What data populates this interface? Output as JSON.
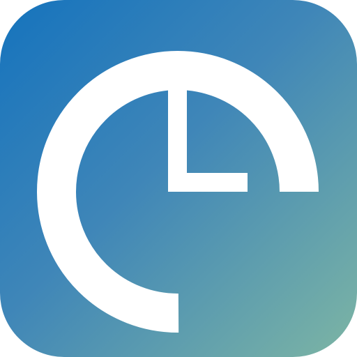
{
  "icon": {
    "name": "clock-icon",
    "colors": {
      "gradient_start": "#1573bd",
      "gradient_mid": "#3f86b8",
      "gradient_end": "#7db5a4",
      "glyph": "#ffffff"
    }
  }
}
